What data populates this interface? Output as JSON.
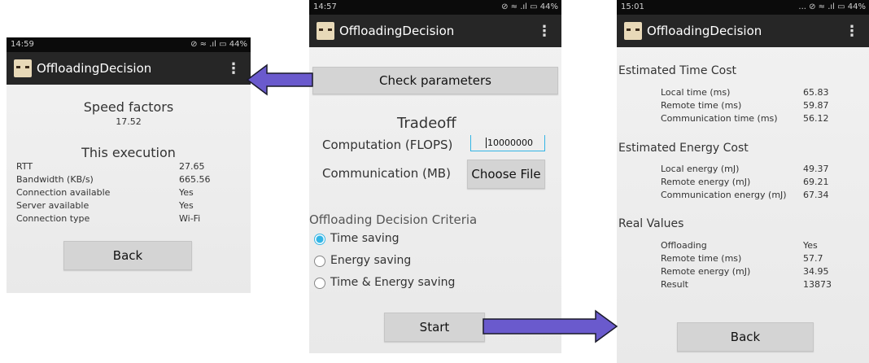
{
  "app": {
    "title": "OffloadingDecision"
  },
  "left": {
    "status_time": "14:59",
    "status_icons": "⊘ ≈ .ıl ▭ 44%",
    "speed_heading": "Speed factors",
    "speed_value": "17.52",
    "exec_heading": "This execution",
    "rows": [
      {
        "label": "RTT",
        "value": "27.65"
      },
      {
        "label": "Bandwidth (KB/s)",
        "value": "665.56"
      },
      {
        "label": "Connection available",
        "value": "Yes"
      },
      {
        "label": "Server available",
        "value": "Yes"
      },
      {
        "label": "Connection type",
        "value": "Wi-Fi"
      }
    ],
    "back": "Back"
  },
  "middle": {
    "status_time": "14:57",
    "status_icons": "⊘ ≈ .ıl ▭ 44%",
    "check_button": "Check parameters",
    "tradeoff_heading": "Tradeoff",
    "computation_label": "Computation (FLOPS)",
    "computation_value": "10000000",
    "communication_label": "Communication (MB)",
    "choose_file": "Choose File",
    "criteria_heading": "Offloading Decision Criteria",
    "options": [
      "Time saving",
      "Energy saving",
      "Time & Energy saving"
    ],
    "selected_option": "Time saving",
    "start": "Start"
  },
  "right": {
    "status_time": "15:01",
    "status_icons": "... ⊘ ≈ .ıl ▭ 44%",
    "time_heading": "Estimated Time Cost",
    "time_rows": [
      {
        "label": "Local time (ms)",
        "value": "65.83"
      },
      {
        "label": "Remote time (ms)",
        "value": "59.87"
      },
      {
        "label": "Communication time (ms)",
        "value": "56.12"
      }
    ],
    "energy_heading": "Estimated Energy Cost",
    "energy_rows": [
      {
        "label": "Local energy (mJ)",
        "value": "49.37"
      },
      {
        "label": "Remote energy (mJ)",
        "value": "69.21"
      },
      {
        "label": "Communication energy (mJ)",
        "value": "67.34"
      }
    ],
    "real_heading": "Real Values",
    "real_rows": [
      {
        "label": "Offloading",
        "value": "Yes"
      },
      {
        "label": "Remote time (ms)",
        "value": "57.7"
      },
      {
        "label": "Remote energy (mJ)",
        "value": "34.95"
      },
      {
        "label": "Result",
        "value": "13873"
      }
    ],
    "back": "Back"
  },
  "colors": {
    "arrow_fill": "#6a5acd",
    "radio_accent": "#33b5e5",
    "appbar": "#262626"
  }
}
